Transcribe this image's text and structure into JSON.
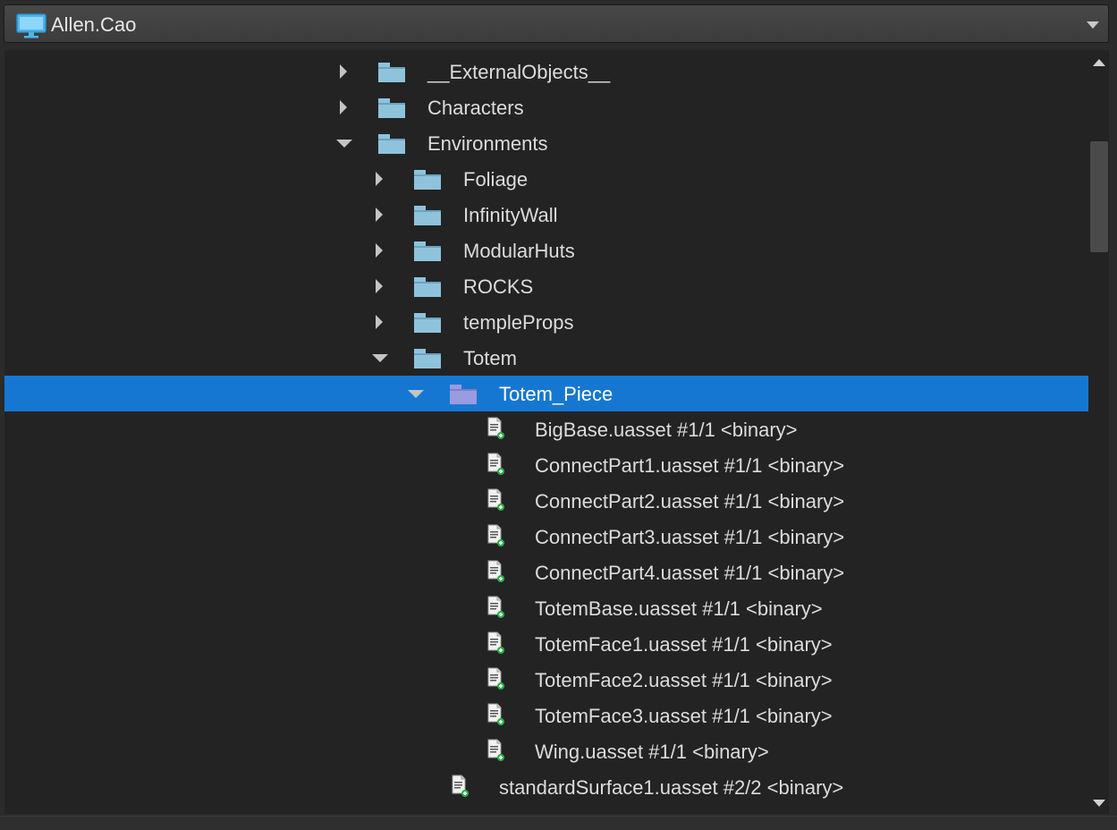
{
  "workspace": {
    "name": "Allen.Cao",
    "icon": "monitor-icon",
    "icon_color": "#4fb6ec"
  },
  "colors": {
    "folder": "#8fc3dc",
    "selected_row": "#1677d2",
    "selected_folder": "#9b9be0",
    "file_badge": "#2db04a"
  },
  "tree": {
    "rows": [
      {
        "label": "__ExternalObjects__",
        "kind": "folder",
        "expanded": false,
        "depth": 0
      },
      {
        "label": "Characters",
        "kind": "folder",
        "expanded": false,
        "depth": 0
      },
      {
        "label": "Environments",
        "kind": "folder",
        "expanded": true,
        "depth": 0
      },
      {
        "label": "Foliage",
        "kind": "folder",
        "expanded": false,
        "depth": 1
      },
      {
        "label": "InfinityWall",
        "kind": "folder",
        "expanded": false,
        "depth": 1
      },
      {
        "label": "ModularHuts",
        "kind": "folder",
        "expanded": false,
        "depth": 1
      },
      {
        "label": "ROCKS",
        "kind": "folder",
        "expanded": false,
        "depth": 1
      },
      {
        "label": "templeProps",
        "kind": "folder",
        "expanded": false,
        "depth": 1
      },
      {
        "label": "Totem",
        "kind": "folder",
        "expanded": true,
        "depth": 1
      },
      {
        "label": "Totem_Piece",
        "kind": "folder",
        "expanded": true,
        "depth": 2,
        "selected": true
      },
      {
        "label": "BigBase.uasset #1/1 <binary>",
        "kind": "file",
        "depth": 3
      },
      {
        "label": "ConnectPart1.uasset #1/1 <binary>",
        "kind": "file",
        "depth": 3
      },
      {
        "label": "ConnectPart2.uasset #1/1 <binary>",
        "kind": "file",
        "depth": 3
      },
      {
        "label": "ConnectPart3.uasset #1/1 <binary>",
        "kind": "file",
        "depth": 3
      },
      {
        "label": "ConnectPart4.uasset #1/1 <binary>",
        "kind": "file",
        "depth": 3
      },
      {
        "label": "TotemBase.uasset #1/1 <binary>",
        "kind": "file",
        "depth": 3
      },
      {
        "label": "TotemFace1.uasset #1/1 <binary>",
        "kind": "file",
        "depth": 3
      },
      {
        "label": "TotemFace2.uasset #1/1 <binary>",
        "kind": "file",
        "depth": 3
      },
      {
        "label": "TotemFace3.uasset #1/1 <binary>",
        "kind": "file",
        "depth": 3
      },
      {
        "label": "Wing.uasset #1/1 <binary>",
        "kind": "file",
        "depth": 3
      },
      {
        "label": "standardSurface1.uasset #2/2 <binary>",
        "kind": "file",
        "depth": 2
      }
    ]
  }
}
